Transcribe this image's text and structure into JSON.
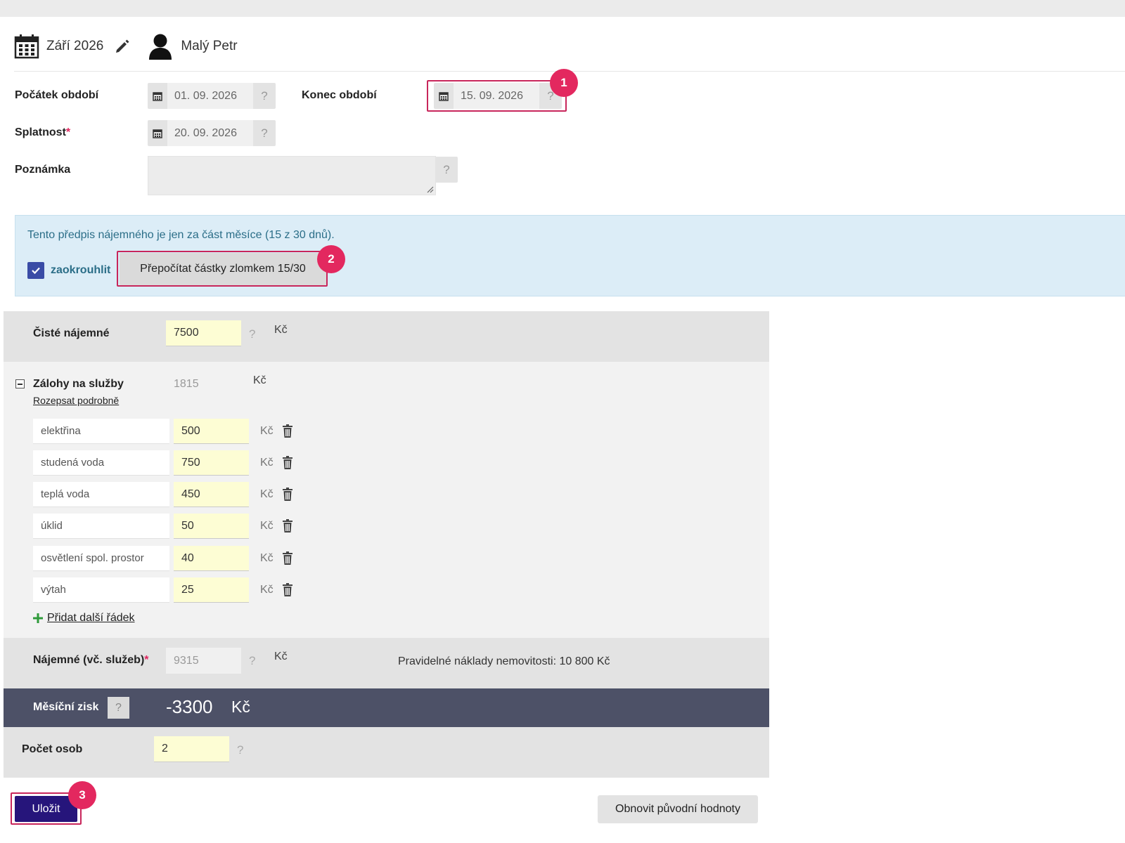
{
  "header": {
    "month": "Září 2026",
    "user": "Malý Petr"
  },
  "form": {
    "start_label": "Počátek období",
    "start_value": "01. 09. 2026",
    "end_label": "Konec období",
    "end_value": "15. 09. 2026",
    "due_label": "Splatnost",
    "due_value": "20. 09. 2026",
    "required_mark": "*",
    "note_label": "Poznámka",
    "note_value": "",
    "help": "?"
  },
  "info": {
    "message": "Tento předpis nájemného je jen za část měsíce (15 z 30 dnů).",
    "round_label": "zaokrouhlit",
    "round_checked": true,
    "recalc_button": "Přepočítat částky zlomkem 15/30"
  },
  "rent": {
    "net_label": "Čisté nájemné",
    "net_value": "7500",
    "currency": "Kč",
    "services_label": "Zálohy na služby",
    "services_total": "1815",
    "detail_link": "Rozepsat podrobně",
    "services": [
      {
        "name": "elektřina",
        "value": "500"
      },
      {
        "name": "studená voda",
        "value": "750"
      },
      {
        "name": "teplá voda",
        "value": "450"
      },
      {
        "name": "úklid",
        "value": "50"
      },
      {
        "name": "osvětlení spol. prostor",
        "value": "40"
      },
      {
        "name": "výtah",
        "value": "25"
      }
    ],
    "add_row": "Přidat další řádek",
    "total_label": "Nájemné (vč. služeb)",
    "total_value": "9315",
    "costs_text": "Pravidelné náklady nemovitosti: 10 800 Kč",
    "profit_label": "Měsíční zisk",
    "profit_value": "-3300",
    "persons_label": "Počet osob",
    "persons_value": "2"
  },
  "actions": {
    "save": "Uložit",
    "restore": "Obnovit původní hodnoty"
  },
  "badges": [
    "1",
    "2",
    "3"
  ],
  "colors": {
    "accent": "#26157b",
    "callout": "#e3285f",
    "profit_bg": "#4d5167",
    "info_bg": "#dcedf7"
  }
}
